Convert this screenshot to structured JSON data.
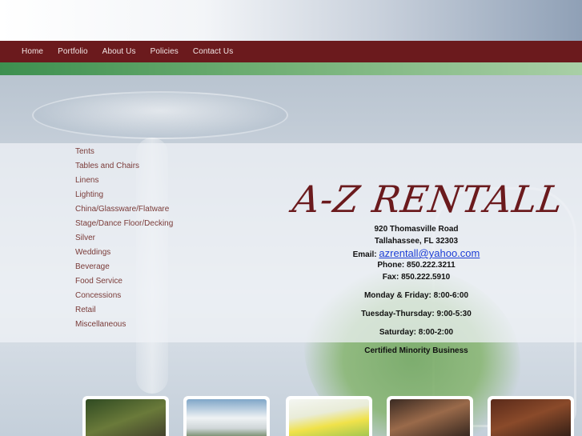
{
  "nav": {
    "items": [
      "Home",
      "Portfolio",
      "About Us",
      "Policies",
      "Contact Us"
    ]
  },
  "menu": {
    "items": [
      "Tents",
      "Tables and Chairs",
      "Linens",
      "Lighting",
      "China/Glassware/Flatware",
      "Stage/Dance Floor/Decking",
      "Silver",
      "Weddings",
      "Beverage",
      "Food Service",
      "Concessions",
      "Retail",
      "Miscellaneous"
    ]
  },
  "business": {
    "name": "A-Z RENTALL",
    "address1": "920 Thomasville Road",
    "address2": "Tallahassee, FL 32303",
    "email_label": "Email:",
    "email": "azrentall@yahoo.com",
    "phone": "Phone: 850.222.3211",
    "fax": "Fax: 850.222.5910",
    "hours1": "Monday & Friday:  8:00-6:00",
    "hours2": "Tuesday-Thursday:  9:00-5:30",
    "hours3": "Saturday:  8:00-2:00",
    "certified": "Certified Minority Business"
  },
  "colors": {
    "nav_bg": "#6b1a1d",
    "logo": "#6b1a1d",
    "menu_text": "#7a3b38",
    "email_link": "#1d3fd6"
  }
}
